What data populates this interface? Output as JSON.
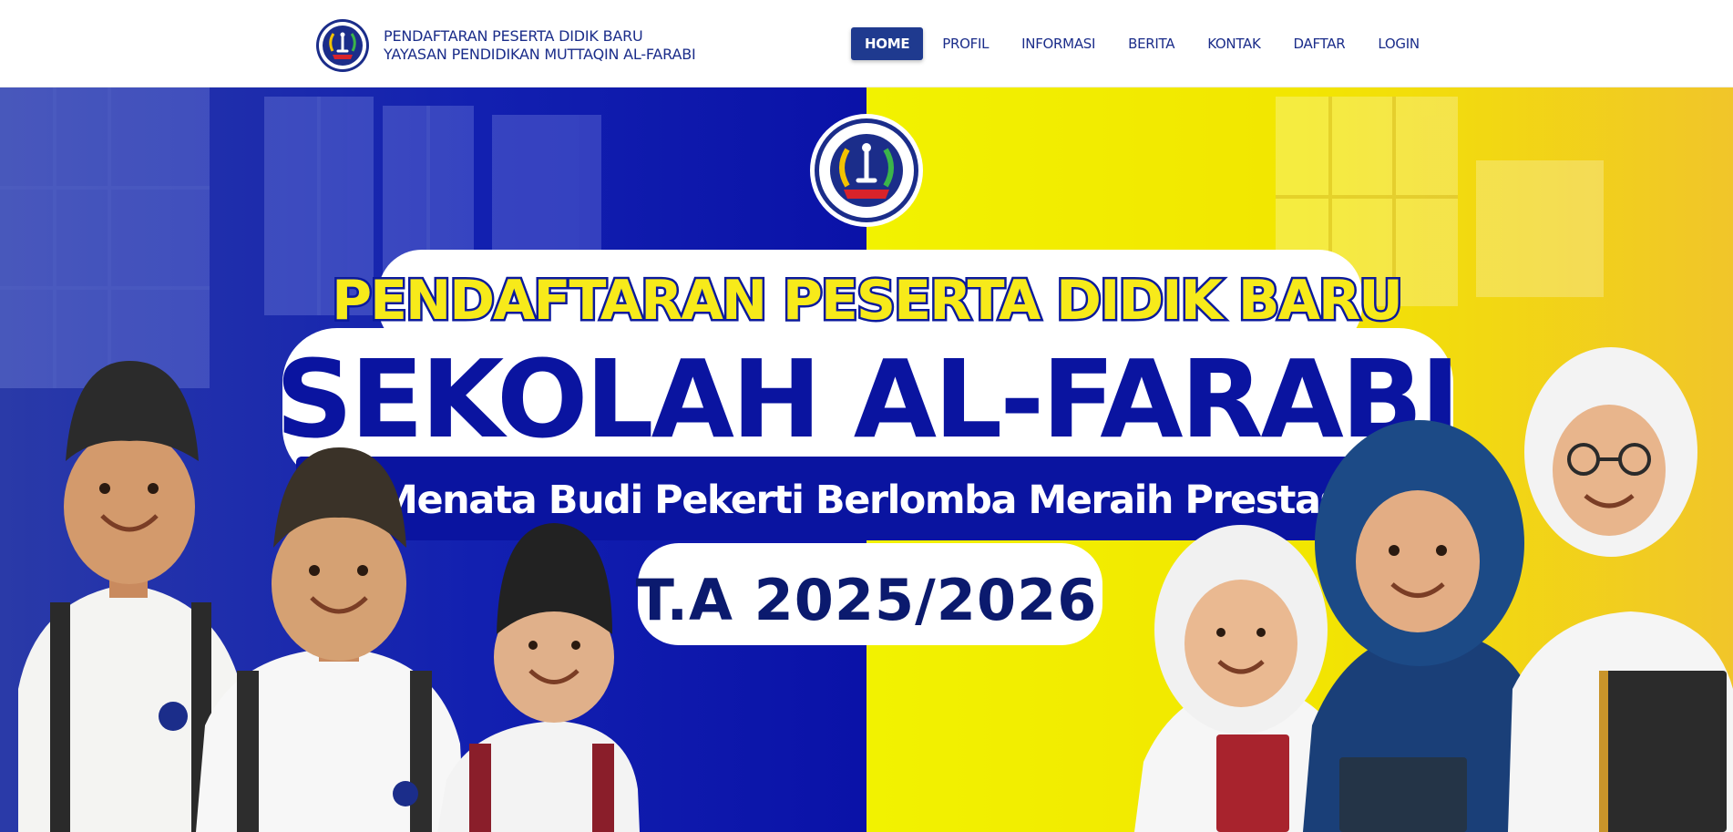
{
  "header": {
    "brand_line_1": "PENDAFTARAN PESERTA DIDIK BARU",
    "brand_line_2": "YAYASAN PENDIDIKAN MUTTAQIN AL-FARABI",
    "logo_icon": "school-crest-icon"
  },
  "nav": {
    "items": [
      {
        "label": "HOME",
        "active": true
      },
      {
        "label": "PROFIL",
        "active": false
      },
      {
        "label": "INFORMASI",
        "active": false
      },
      {
        "label": "BERITA",
        "active": false
      },
      {
        "label": "KONTAK",
        "active": false
      },
      {
        "label": "DAFTAR",
        "active": false
      },
      {
        "label": "LOGIN",
        "active": false
      }
    ]
  },
  "hero": {
    "title_line_1": "PENDAFTARAN PESERTA DIDIK BARU",
    "title_line_2": "SEKOLAH AL-FARABI",
    "tagline": "Menata Budi Pekerti Berlomba Meraih Prestasi",
    "year": "T.A 2025/2026",
    "logo_icon": "school-crest-icon"
  },
  "colors": {
    "brand_navy": "#1b2d8a",
    "active_nav_bg": "#1f3a8f",
    "hero_left_blue": "#0a14a0",
    "hero_right_yellow": "#f3e800"
  }
}
